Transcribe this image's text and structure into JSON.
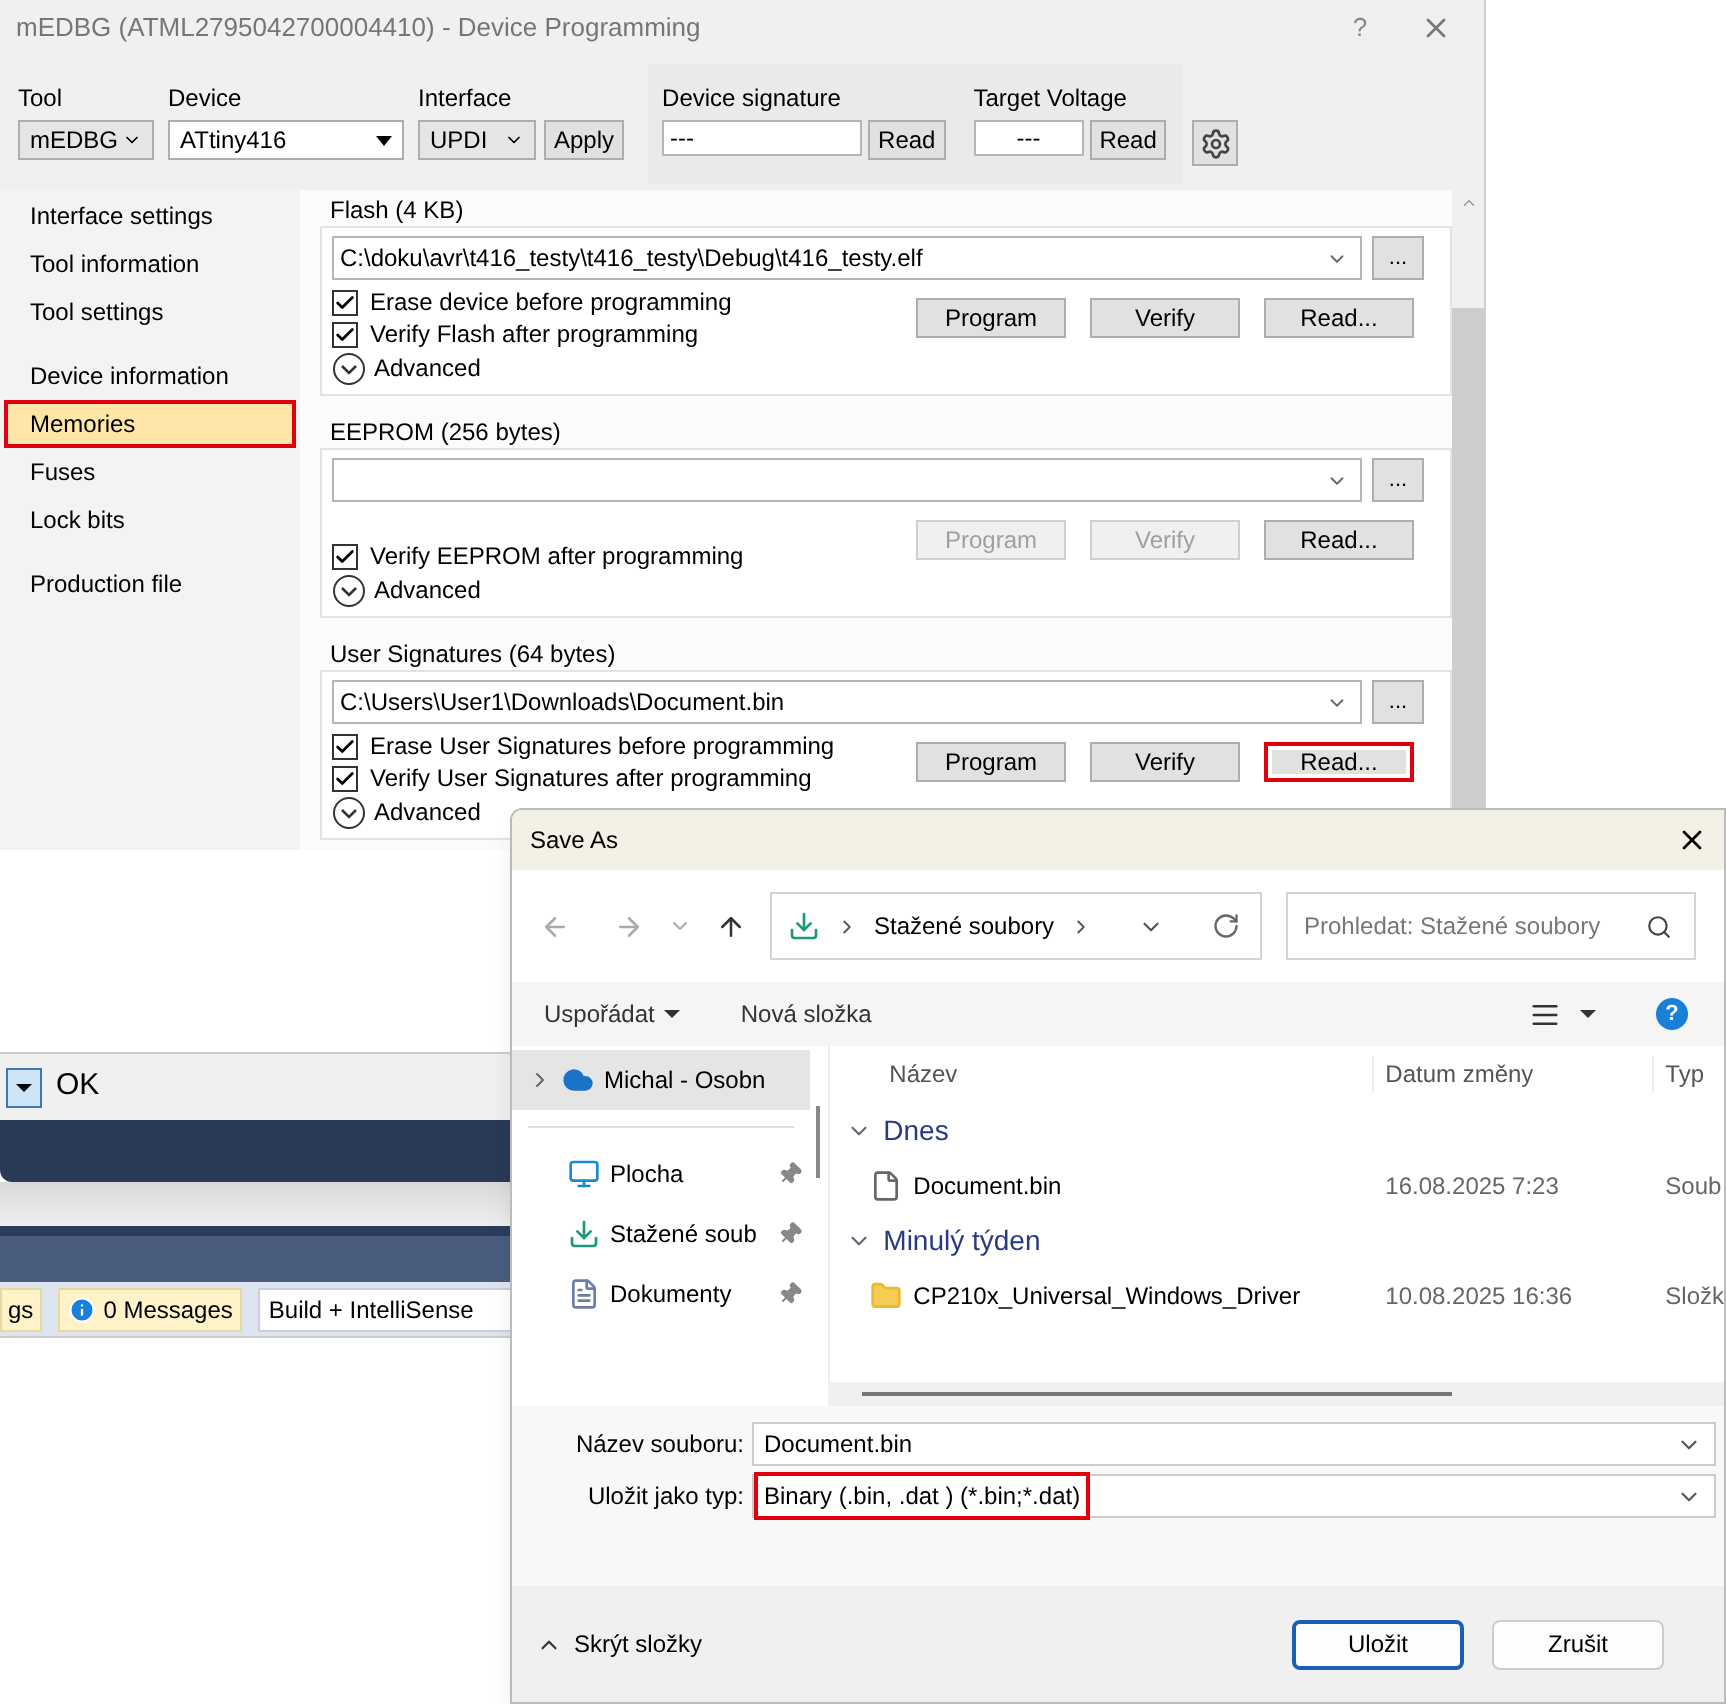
{
  "main_window": {
    "title": "mEDBG (ATML2795042700004410) - Device Programming",
    "help": "?",
    "toolbar": {
      "tool": {
        "label": "Tool",
        "value": "mEDBG"
      },
      "device": {
        "label": "Device",
        "value": "ATtiny416"
      },
      "interface": {
        "label": "Interface",
        "value": "UPDI"
      },
      "apply": "Apply",
      "readouts": [
        {
          "label": "Device signature",
          "value": "---",
          "button": "Read"
        },
        {
          "label": "Target Voltage",
          "value": "---",
          "button": "Read"
        }
      ]
    },
    "sidebar": {
      "groups": [
        {
          "items": [
            {
              "label": "Interface settings",
              "selected": false,
              "highlighted": false
            },
            {
              "label": "Tool information",
              "selected": false,
              "highlighted": false
            },
            {
              "label": "Tool settings",
              "selected": false,
              "highlighted": false
            }
          ]
        },
        {
          "items": [
            {
              "label": "Device information",
              "selected": false,
              "highlighted": false
            },
            {
              "label": "Memories",
              "selected": true,
              "highlighted": true
            },
            {
              "label": "Fuses",
              "selected": false,
              "highlighted": false
            },
            {
              "label": "Lock bits",
              "selected": false,
              "highlighted": false
            }
          ]
        },
        {
          "items": [
            {
              "label": "Production file",
              "selected": false,
              "highlighted": false
            }
          ]
        }
      ]
    },
    "memories": [
      {
        "title": "Flash (4 KB)",
        "path": "C:\\doku\\avr\\t416_testy\\t416_testy\\Debug\\t416_testy.elf",
        "options": [
          {
            "label": "Erase device before programming",
            "checked": true
          },
          {
            "label": "Verify Flash after programming",
            "checked": true
          }
        ],
        "buttons": [
          {
            "label": "Program",
            "disabled": false,
            "highlighted": false
          },
          {
            "label": "Verify",
            "disabled": false,
            "highlighted": false
          },
          {
            "label": "Read...",
            "disabled": false,
            "highlighted": false
          }
        ],
        "advanced": "Advanced",
        "browse": "..."
      },
      {
        "title": "EEPROM (256 bytes)",
        "options": [
          {
            "label": "Verify EEPROM after programming",
            "checked": true
          }
        ],
        "buttons": [
          {
            "label": "Program",
            "disabled": true,
            "highlighted": false
          },
          {
            "label": "Verify",
            "disabled": true,
            "highlighted": false
          },
          {
            "label": "Read...",
            "disabled": false,
            "highlighted": false
          }
        ],
        "advanced": "Advanced",
        "browse": "..."
      },
      {
        "title": "User Signatures (64 bytes)",
        "path": "C:\\Users\\User1\\Downloads\\Document.bin",
        "options": [
          {
            "label": "Erase User Signatures before programming",
            "checked": true
          },
          {
            "label": "Verify User Signatures after programming",
            "checked": true
          }
        ],
        "buttons": [
          {
            "label": "Program",
            "disabled": false,
            "highlighted": false
          },
          {
            "label": "Verify",
            "disabled": false,
            "highlighted": false
          },
          {
            "label": "Read...",
            "disabled": false,
            "highlighted": true
          }
        ],
        "advanced": "Advanced",
        "browse": "..."
      }
    ]
  },
  "background": {
    "ok_bar": "OK",
    "status_items": [
      {
        "kind": "badge",
        "label": "gs"
      },
      {
        "kind": "info",
        "label": "0 Messages"
      },
      {
        "kind": "field",
        "label": "Build + IntelliSense"
      }
    ]
  },
  "save_dialog": {
    "title": "Save As",
    "location": "Stažené soubory",
    "search": {
      "placeholder": "Prohledat: Stažené soubory"
    },
    "commands": {
      "organize": "Uspořádat",
      "new_folder": "Nová složka",
      "help": "?"
    },
    "nav": [
      {
        "kind": "cloud",
        "label": "Michal - Osobn",
        "selected": true,
        "pinned": false
      },
      {
        "kind": "desktop",
        "label": "Plocha",
        "selected": false,
        "pinned": true
      },
      {
        "kind": "download",
        "label": "Stažené soub",
        "selected": false,
        "pinned": true
      },
      {
        "kind": "documents",
        "label": "Dokumenty",
        "selected": false,
        "pinned": true
      }
    ],
    "columns": [
      "Název",
      "Datum změny",
      "Typ"
    ],
    "groups": [
      {
        "title": "Dnes",
        "files": [
          {
            "kind": "file",
            "name": "Document.bin",
            "date": "16.08.2025 7:23",
            "type": "Soub"
          }
        ]
      },
      {
        "title": "Minulý týden",
        "files": [
          {
            "kind": "folder",
            "name": "CP210x_Universal_Windows_Driver",
            "date": "10.08.2025 16:36",
            "type": "Složk"
          }
        ]
      }
    ],
    "filename": {
      "label": "Název souboru:",
      "value": "Document.bin"
    },
    "filetype": {
      "label": "Uložit jako typ:",
      "value": "Binary (.bin, .dat ) (*.bin;*.dat)",
      "highlighted": true
    },
    "hide_folders": "Skrýt složky",
    "buttons": [
      {
        "label": "Uložit",
        "primary": true
      },
      {
        "label": "Zrušit",
        "primary": false
      }
    ]
  }
}
